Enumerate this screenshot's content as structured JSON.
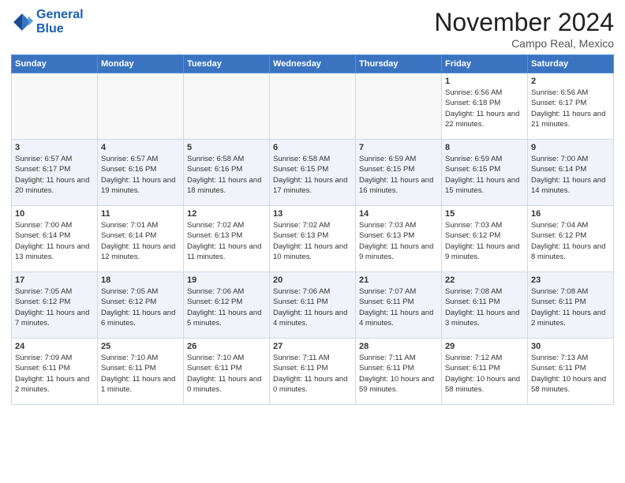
{
  "logo": {
    "line1": "General",
    "line2": "Blue"
  },
  "title": "November 2024",
  "subtitle": "Campo Real, Mexico",
  "weekdays": [
    "Sunday",
    "Monday",
    "Tuesday",
    "Wednesday",
    "Thursday",
    "Friday",
    "Saturday"
  ],
  "weeks": [
    [
      {
        "day": "",
        "info": ""
      },
      {
        "day": "",
        "info": ""
      },
      {
        "day": "",
        "info": ""
      },
      {
        "day": "",
        "info": ""
      },
      {
        "day": "",
        "info": ""
      },
      {
        "day": "1",
        "info": "Sunrise: 6:56 AM\nSunset: 6:18 PM\nDaylight: 11 hours and 22 minutes."
      },
      {
        "day": "2",
        "info": "Sunrise: 6:56 AM\nSunset: 6:17 PM\nDaylight: 11 hours and 21 minutes."
      }
    ],
    [
      {
        "day": "3",
        "info": "Sunrise: 6:57 AM\nSunset: 6:17 PM\nDaylight: 11 hours and 20 minutes."
      },
      {
        "day": "4",
        "info": "Sunrise: 6:57 AM\nSunset: 6:16 PM\nDaylight: 11 hours and 19 minutes."
      },
      {
        "day": "5",
        "info": "Sunrise: 6:58 AM\nSunset: 6:16 PM\nDaylight: 11 hours and 18 minutes."
      },
      {
        "day": "6",
        "info": "Sunrise: 6:58 AM\nSunset: 6:15 PM\nDaylight: 11 hours and 17 minutes."
      },
      {
        "day": "7",
        "info": "Sunrise: 6:59 AM\nSunset: 6:15 PM\nDaylight: 11 hours and 16 minutes."
      },
      {
        "day": "8",
        "info": "Sunrise: 6:59 AM\nSunset: 6:15 PM\nDaylight: 11 hours and 15 minutes."
      },
      {
        "day": "9",
        "info": "Sunrise: 7:00 AM\nSunset: 6:14 PM\nDaylight: 11 hours and 14 minutes."
      }
    ],
    [
      {
        "day": "10",
        "info": "Sunrise: 7:00 AM\nSunset: 6:14 PM\nDaylight: 11 hours and 13 minutes."
      },
      {
        "day": "11",
        "info": "Sunrise: 7:01 AM\nSunset: 6:14 PM\nDaylight: 11 hours and 12 minutes."
      },
      {
        "day": "12",
        "info": "Sunrise: 7:02 AM\nSunset: 6:13 PM\nDaylight: 11 hours and 11 minutes."
      },
      {
        "day": "13",
        "info": "Sunrise: 7:02 AM\nSunset: 6:13 PM\nDaylight: 11 hours and 10 minutes."
      },
      {
        "day": "14",
        "info": "Sunrise: 7:03 AM\nSunset: 6:13 PM\nDaylight: 11 hours and 9 minutes."
      },
      {
        "day": "15",
        "info": "Sunrise: 7:03 AM\nSunset: 6:12 PM\nDaylight: 11 hours and 9 minutes."
      },
      {
        "day": "16",
        "info": "Sunrise: 7:04 AM\nSunset: 6:12 PM\nDaylight: 11 hours and 8 minutes."
      }
    ],
    [
      {
        "day": "17",
        "info": "Sunrise: 7:05 AM\nSunset: 6:12 PM\nDaylight: 11 hours and 7 minutes."
      },
      {
        "day": "18",
        "info": "Sunrise: 7:05 AM\nSunset: 6:12 PM\nDaylight: 11 hours and 6 minutes."
      },
      {
        "day": "19",
        "info": "Sunrise: 7:06 AM\nSunset: 6:12 PM\nDaylight: 11 hours and 5 minutes."
      },
      {
        "day": "20",
        "info": "Sunrise: 7:06 AM\nSunset: 6:11 PM\nDaylight: 11 hours and 4 minutes."
      },
      {
        "day": "21",
        "info": "Sunrise: 7:07 AM\nSunset: 6:11 PM\nDaylight: 11 hours and 4 minutes."
      },
      {
        "day": "22",
        "info": "Sunrise: 7:08 AM\nSunset: 6:11 PM\nDaylight: 11 hours and 3 minutes."
      },
      {
        "day": "23",
        "info": "Sunrise: 7:08 AM\nSunset: 6:11 PM\nDaylight: 11 hours and 2 minutes."
      }
    ],
    [
      {
        "day": "24",
        "info": "Sunrise: 7:09 AM\nSunset: 6:11 PM\nDaylight: 11 hours and 2 minutes."
      },
      {
        "day": "25",
        "info": "Sunrise: 7:10 AM\nSunset: 6:11 PM\nDaylight: 11 hours and 1 minute."
      },
      {
        "day": "26",
        "info": "Sunrise: 7:10 AM\nSunset: 6:11 PM\nDaylight: 11 hours and 0 minutes."
      },
      {
        "day": "27",
        "info": "Sunrise: 7:11 AM\nSunset: 6:11 PM\nDaylight: 11 hours and 0 minutes."
      },
      {
        "day": "28",
        "info": "Sunrise: 7:11 AM\nSunset: 6:11 PM\nDaylight: 10 hours and 59 minutes."
      },
      {
        "day": "29",
        "info": "Sunrise: 7:12 AM\nSunset: 6:11 PM\nDaylight: 10 hours and 58 minutes."
      },
      {
        "day": "30",
        "info": "Sunrise: 7:13 AM\nSunset: 6:11 PM\nDaylight: 10 hours and 58 minutes."
      }
    ]
  ]
}
